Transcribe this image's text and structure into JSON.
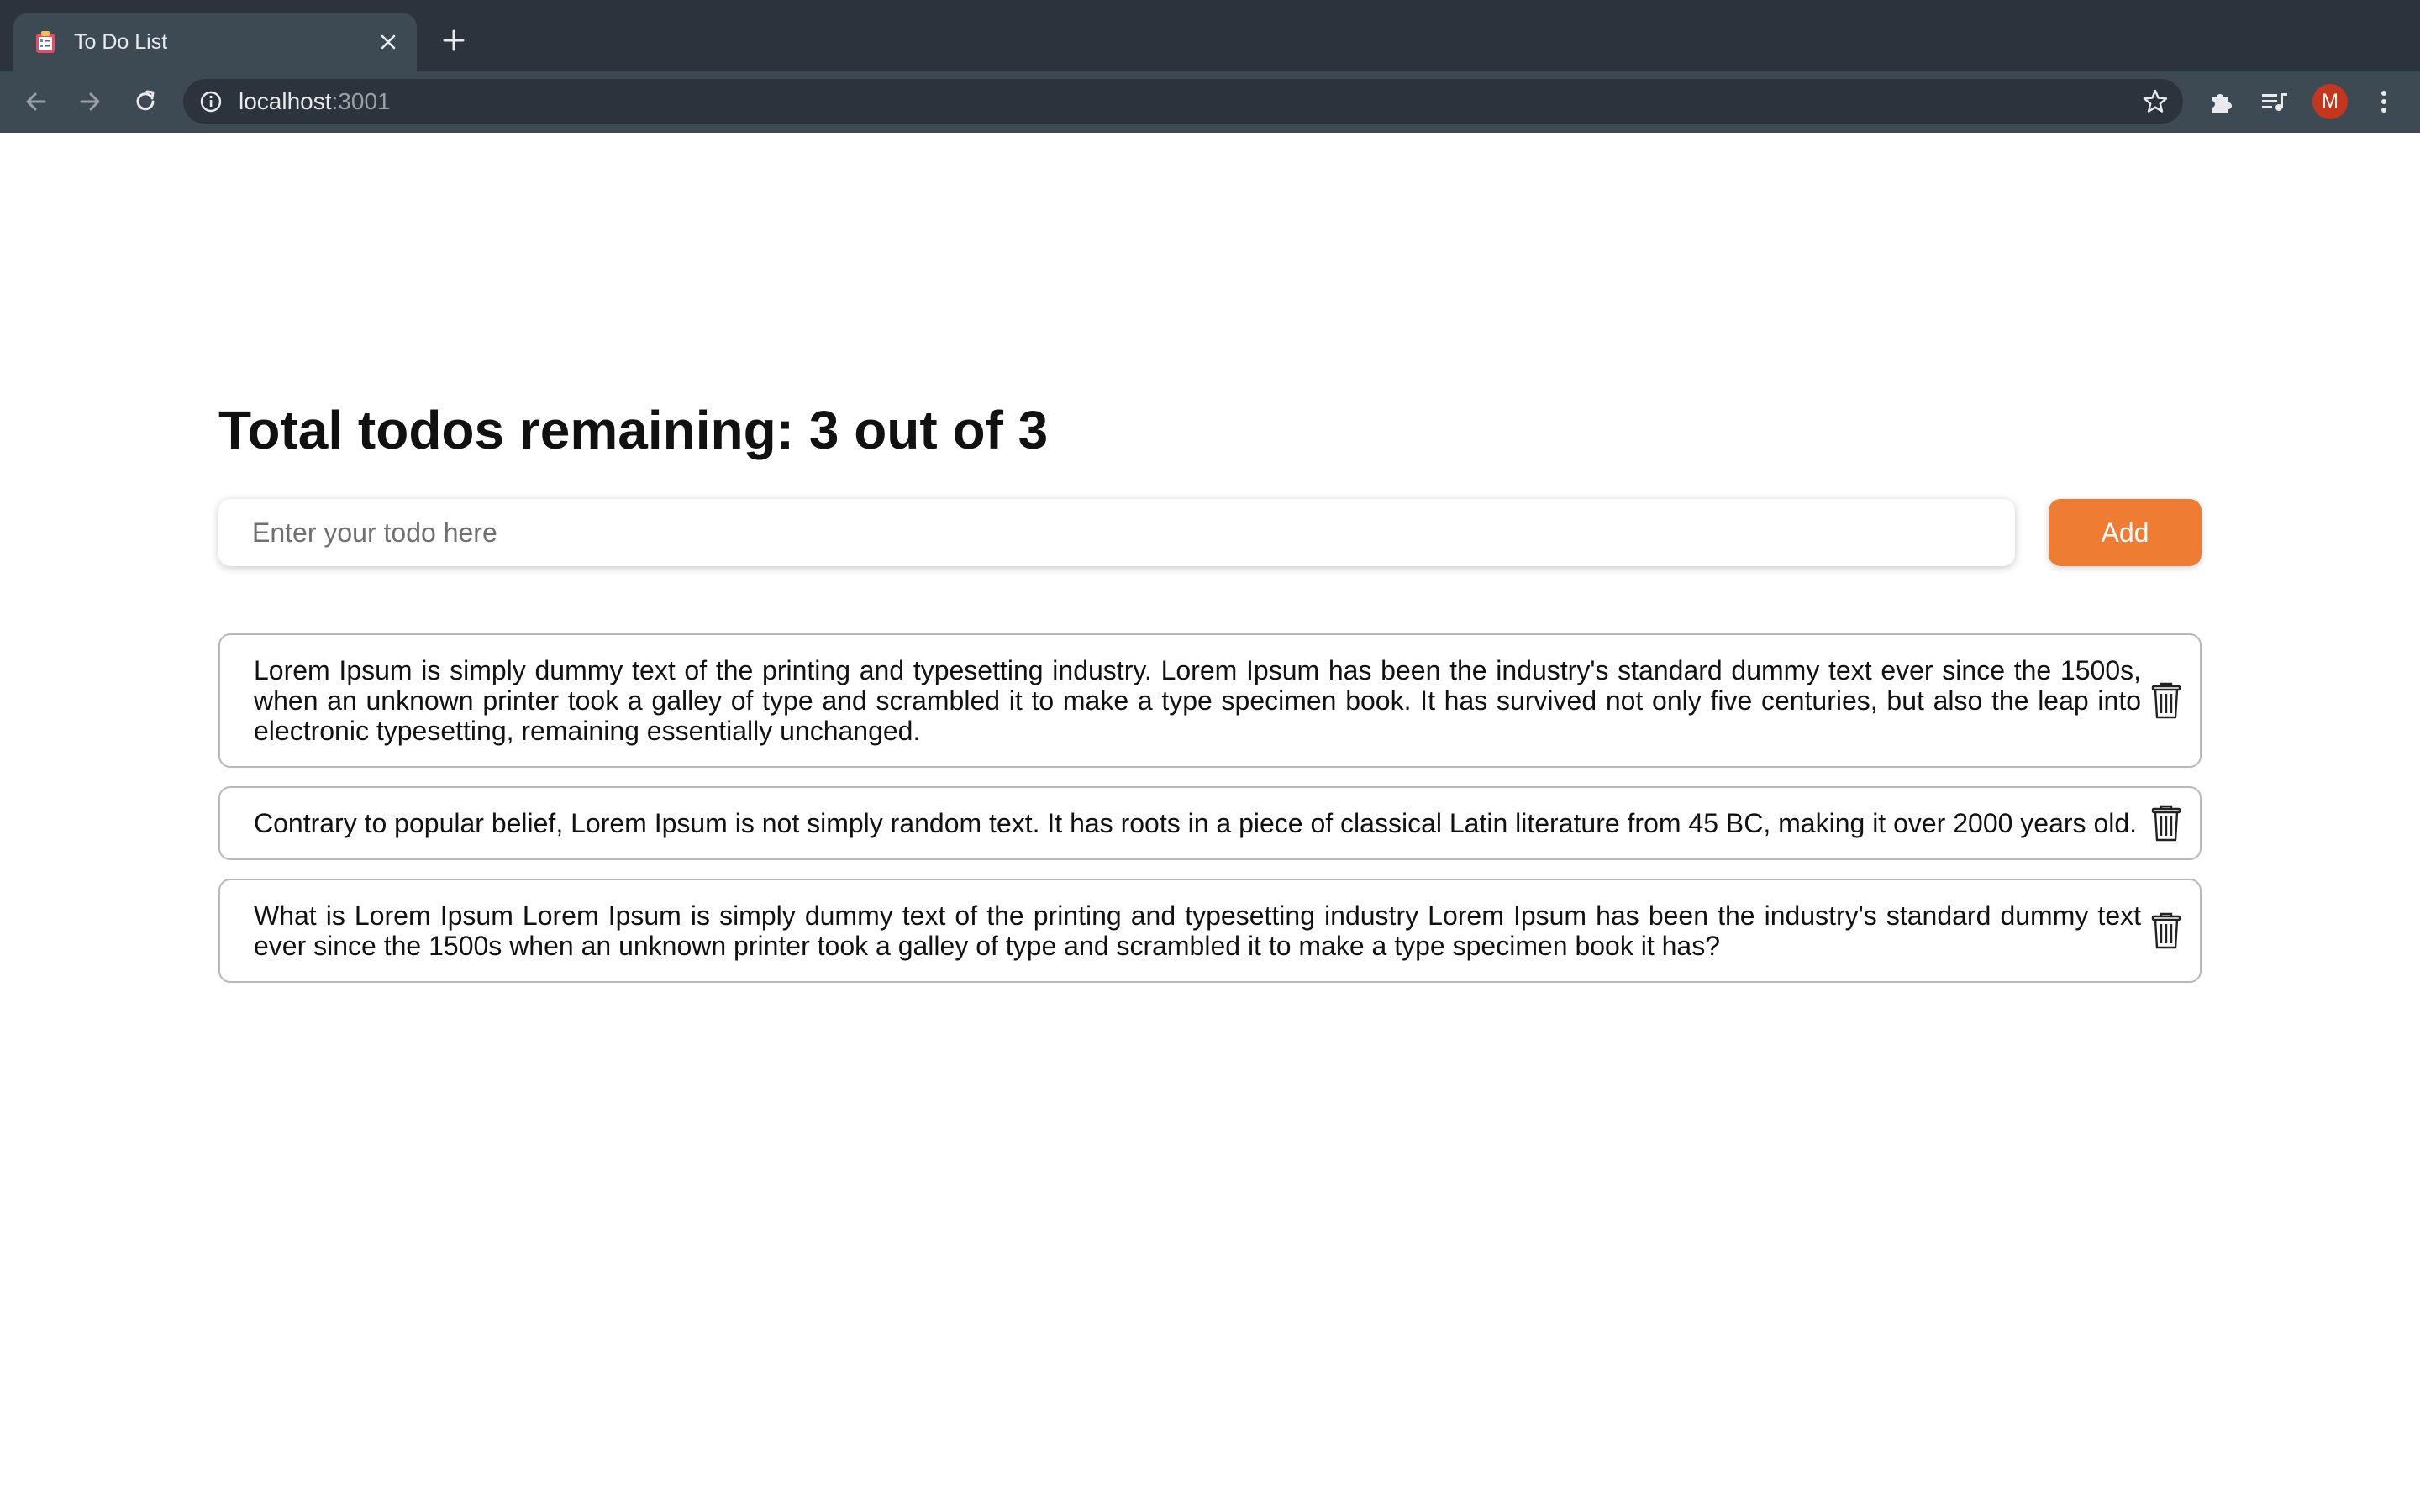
{
  "browser": {
    "tab": {
      "title": "To Do List",
      "favicon": "clipboard-checklist-icon",
      "close_icon": "close-icon"
    },
    "new_tab_icon": "plus-icon",
    "toolbar": {
      "back_icon": "back-arrow-icon",
      "forward_icon": "forward-arrow-icon",
      "reload_icon": "reload-icon",
      "info_icon": "info-icon",
      "url_host": "localhost",
      "url_port": ":3001",
      "bookmark_icon": "star-icon",
      "extensions_icon": "puzzle-icon",
      "media_icon": "playlist-icon",
      "profile_initial": "M",
      "menu_icon": "kebab-menu-icon"
    },
    "colors": {
      "tabstrip": "#2b343c",
      "toolbar": "#3d4a54",
      "avatar": "#c5361f"
    }
  },
  "app": {
    "heading": "Total todos remaining: 3 out of 3",
    "todo_input": {
      "placeholder": "Enter your todo here",
      "value": ""
    },
    "add_button_label": "Add",
    "accent_color": "#ef7c33",
    "todos": [
      {
        "text": "Lorem Ipsum is simply dummy text of the printing and typesetting industry. Lorem Ipsum has been the industry's standard dummy text ever since the 1500s, when an unknown printer took a galley of type and scrambled it to make a type specimen book. It has survived not only five centuries, but also the leap into electronic typesetting, remaining essentially unchanged.",
        "delete_icon": "trash-icon"
      },
      {
        "text": "Contrary to popular belief, Lorem Ipsum is not simply random text. It has roots in a piece of classical Latin literature from 45 BC, making it over 2000 years old.",
        "delete_icon": "trash-icon"
      },
      {
        "text": "What is Lorem Ipsum Lorem Ipsum is simply dummy text of the printing and typesetting industry Lorem Ipsum has been the industry's standard dummy text ever since the 1500s when an unknown printer took a galley of type and scrambled it to make a type specimen book it has?",
        "delete_icon": "trash-icon"
      }
    ]
  }
}
